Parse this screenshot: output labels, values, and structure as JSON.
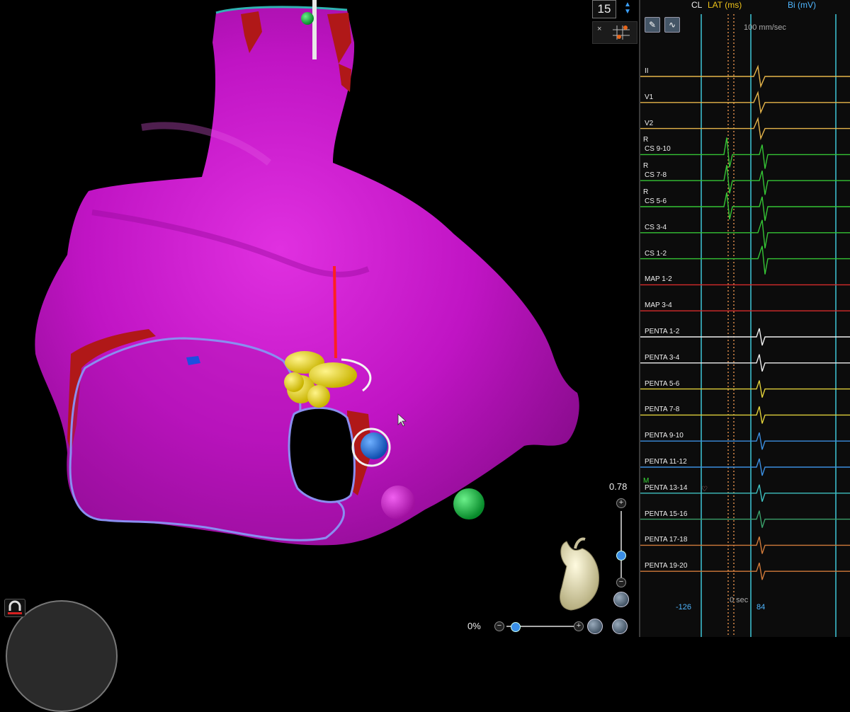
{
  "view3d": {
    "counter": "15",
    "mini_close": "×",
    "opacity_value": "0.78",
    "zoom_value": "0%",
    "plus": "+",
    "minus": "−"
  },
  "ecg": {
    "header": {
      "cl": "CL",
      "lat": "LAT (ms)",
      "bi": "Bi (mV)"
    },
    "speed": "100 mm/sec",
    "channels": [
      {
        "label": "II",
        "color": "#e6b54a",
        "r": ""
      },
      {
        "label": "V1",
        "color": "#e6b54a",
        "r": ""
      },
      {
        "label": "V2",
        "color": "#e6b54a",
        "r": ""
      },
      {
        "label": "CS 9-10",
        "color": "#35c435",
        "r": "R"
      },
      {
        "label": "CS 7-8",
        "color": "#35c435",
        "r": "R"
      },
      {
        "label": "CS 5-6",
        "color": "#35c435",
        "r": "R"
      },
      {
        "label": "CS 3-4",
        "color": "#35c435",
        "r": ""
      },
      {
        "label": "CS 1-2",
        "color": "#35c435",
        "r": ""
      },
      {
        "label": "MAP 1-2",
        "color": "#d62b2b",
        "r": ""
      },
      {
        "label": "MAP 3-4",
        "color": "#d62b2b",
        "r": ""
      },
      {
        "label": "PENTA 1-2",
        "color": "#eeeeee",
        "r": ""
      },
      {
        "label": "PENTA 3-4",
        "color": "#eeeeee",
        "r": ""
      },
      {
        "label": "PENTA 5-6",
        "color": "#e0d03a",
        "r": ""
      },
      {
        "label": "PENTA 7-8",
        "color": "#e0d03a",
        "r": ""
      },
      {
        "label": "PENTA 9-10",
        "color": "#3b8ee0",
        "r": ""
      },
      {
        "label": "PENTA 11-12",
        "color": "#3b8ee0",
        "r": ""
      },
      {
        "label": "PENTA 13-14",
        "color": "#3ec0c0",
        "r": ""
      },
      {
        "label": "PENTA 15-16",
        "color": "#3aa06a",
        "r": ""
      },
      {
        "label": "PENTA 17-18",
        "color": "#d07a3a",
        "r": ""
      },
      {
        "label": "PENTA 19-20",
        "color": "#d07a3a",
        "r": ""
      }
    ],
    "m_marker": "M",
    "heart_marker": "♡",
    "time_label": "0 sec",
    "left_value": "-126",
    "right_value": "84"
  },
  "colors": {
    "chamber": "#cc14cc",
    "scar": "#b01818",
    "ablation": "#e8d400",
    "catheter": "#1e78e6",
    "marker_green": "#11b83a",
    "outline": "#8a8ef0"
  }
}
